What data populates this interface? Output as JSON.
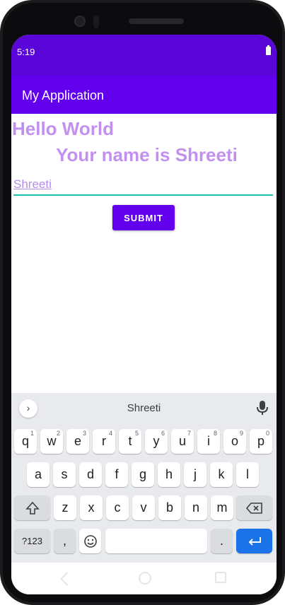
{
  "status": {
    "time": "5:19"
  },
  "appbar": {
    "title": "My Application"
  },
  "content": {
    "hello": "Hello World",
    "name_line": "Your name is Shreeti",
    "input_value": "Shreeti",
    "submit_label": "SUBMIT"
  },
  "keyboard": {
    "suggestion": "Shreeti",
    "row1": [
      {
        "k": "q",
        "s": "1"
      },
      {
        "k": "w",
        "s": "2"
      },
      {
        "k": "e",
        "s": "3"
      },
      {
        "k": "r",
        "s": "4"
      },
      {
        "k": "t",
        "s": "5"
      },
      {
        "k": "y",
        "s": "6"
      },
      {
        "k": "u",
        "s": "7"
      },
      {
        "k": "i",
        "s": "8"
      },
      {
        "k": "o",
        "s": "9"
      },
      {
        "k": "p",
        "s": "0"
      }
    ],
    "row2": [
      "a",
      "s",
      "d",
      "f",
      "g",
      "h",
      "j",
      "k",
      "l"
    ],
    "row3": [
      "z",
      "x",
      "c",
      "v",
      "b",
      "n",
      "m"
    ],
    "sym_label": "?123",
    "comma_label": ",",
    "period_label": ".",
    "enter_icon": "enter-arrow-icon",
    "shift_icon": "shift-icon",
    "backspace_icon": "backspace-icon",
    "emoji_icon": "emoji-icon"
  },
  "colors": {
    "status_bar": "#5a06d8",
    "app_bar": "#6200ee",
    "text_accent": "#c290f0",
    "input_underline": "#18c1b0",
    "enter_key": "#1a73e8"
  }
}
